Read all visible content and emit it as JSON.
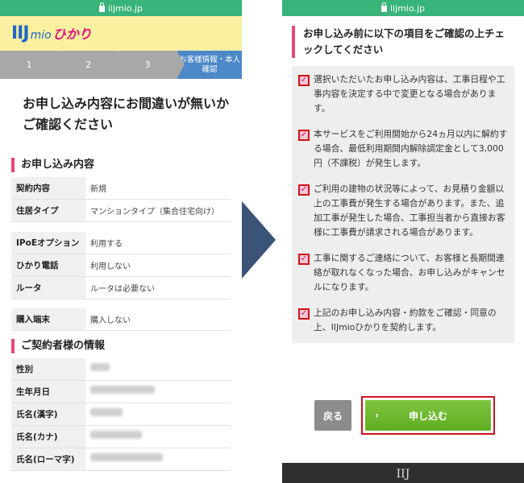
{
  "url": "iijmio.jp",
  "brand": {
    "logo_iij": "IIJ",
    "logo_mio": "mio",
    "logo_hikari": "ひかり"
  },
  "steps": [
    "1",
    "2",
    "3",
    "お客様情報・本人確認"
  ],
  "left": {
    "title": "お申し込み内容にお間違いが無いかご確認ください",
    "section1": "お申し込み内容",
    "order_rows": [
      {
        "label": "契約内容",
        "value": "新規"
      },
      {
        "label": "住居タイプ",
        "value": "マンションタイプ（集合住宅向け）"
      },
      {
        "label": "IPoEオプション",
        "value": "利用する"
      },
      {
        "label": "ひかり電話",
        "value": "利用しない"
      },
      {
        "label": "ルータ",
        "value": "ルータは必要ない"
      },
      {
        "label": "購入端末",
        "value": "購入しない"
      }
    ],
    "section2": "ご契約者様の情報",
    "contract_rows": [
      {
        "label": "性別"
      },
      {
        "label": "生年月日"
      },
      {
        "label": "氏名(漢字)"
      },
      {
        "label": "氏名(カナ)"
      },
      {
        "label": "氏名(ローマ字)"
      }
    ]
  },
  "right": {
    "heading": "お申し込み前に以下の項目をご確認の上チェックしてください",
    "items": [
      "選択いただいたお申し込み内容は、工事日程や工事内容を決定する中で変更となる場合があります。",
      "本サービスをご利用開始から24ヵ月以内に解約する場合、最低利用期間内解除調定金として3,000円（不課税）が発生します。",
      "ご利用の建物の状況等によって、お見積り金額以上の工事費が発生する場合があります。また、追加工事が発生した場合、工事担当者から直接お客様に工事費が請求される場合があります。",
      "工事に関するご連絡について、お客様と長期間連絡が取れなくなった場合、お申し込みがキャンセルになります。",
      "上記のお申し込み内容・約款をご確認・同意の上、IIJmioひかりを契約します。"
    ],
    "back_label": "戻る",
    "apply_label": "申し込む",
    "footer_logo": "IIJ"
  },
  "colors": {
    "url_bar": "#38b37a",
    "accent_pink": "#e8467e",
    "apply_green": "#6cb82f",
    "step_active": "#4d88c8",
    "arrow": "#3a5377"
  }
}
